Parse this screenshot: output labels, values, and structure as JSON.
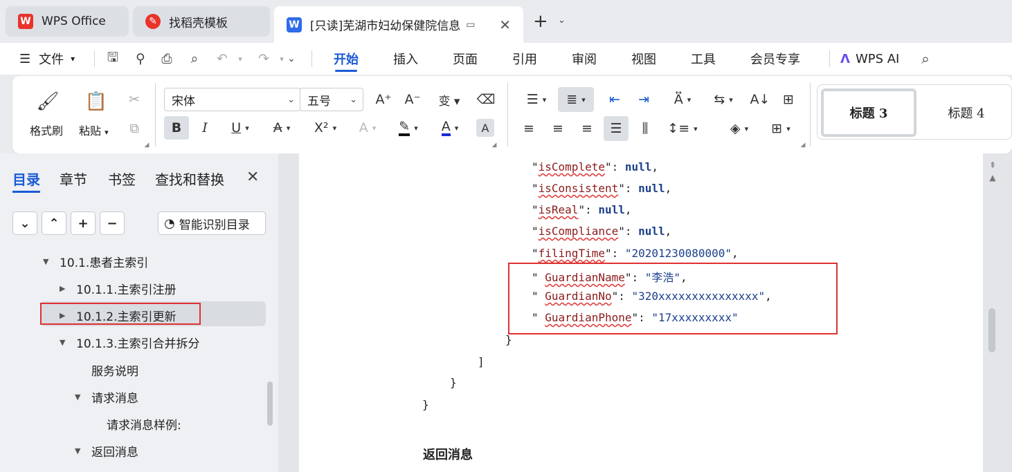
{
  "tabs": [
    {
      "label": "WPS Office",
      "icon": "wps-logo-icon"
    },
    {
      "label": "找稻壳模板",
      "icon": "docer-icon"
    },
    {
      "label": "[只读]芜湖市妇幼保健院信息",
      "icon": "writer-icon"
    }
  ],
  "menu": {
    "file": "文件",
    "tabs": [
      "开始",
      "插入",
      "页面",
      "引用",
      "审阅",
      "视图",
      "工具",
      "会员专享"
    ],
    "ai": "WPS AI"
  },
  "ribbon": {
    "format_painter": "格式刷",
    "paste": "粘贴",
    "font_name": "宋体",
    "font_size": "五号",
    "styles": [
      "标题 3",
      "标题 4"
    ]
  },
  "sidepane": {
    "tabs": [
      "目录",
      "章节",
      "书签",
      "查找和替换"
    ],
    "smart_toc": "智能识别目录",
    "toc": [
      {
        "label": "10.1.患者主索引"
      },
      {
        "label": "10.1.1.主索引注册"
      },
      {
        "label": "10.1.2.主索引更新"
      },
      {
        "label": "10.1.3.主索引合并拆分"
      },
      {
        "label": "服务说明"
      },
      {
        "label": "请求消息"
      },
      {
        "label": "请求消息样例:"
      },
      {
        "label": "返回消息"
      }
    ]
  },
  "document": {
    "lines": [
      {
        "key": "isComplete",
        "value": "null",
        "type": "kw",
        "sep": ","
      },
      {
        "key": "isConsistent",
        "value": "null",
        "type": "kw",
        "sep": ","
      },
      {
        "key": "isReal",
        "value": "null",
        "type": "kw",
        "sep": ","
      },
      {
        "key": "isCompliance",
        "value": "null",
        "type": "kw",
        "sep": ","
      },
      {
        "key": "filingTime",
        "value": "\"20201230080000\"",
        "type": "str",
        "sep": ","
      },
      {
        "key": "GuardianName",
        "value": "\"李浩\"",
        "type": "str",
        "sep": ","
      },
      {
        "key": "GuardianNo",
        "value": "\"320xxxxxxxxxxxxxxx\"",
        "type": "str",
        "sep": ","
      },
      {
        "key": "GuardianPhone",
        "value": "\"17xxxxxxxxx\"",
        "type": "str",
        "sep": ""
      }
    ],
    "closers": [
      "}",
      "]",
      "}",
      "}"
    ],
    "heading": "返回消息"
  },
  "colors": {
    "accent": "#1a5ad6",
    "highlight_box": "#e03030",
    "json_key": "#8b1a1a",
    "json_value": "#1a3f8b"
  }
}
